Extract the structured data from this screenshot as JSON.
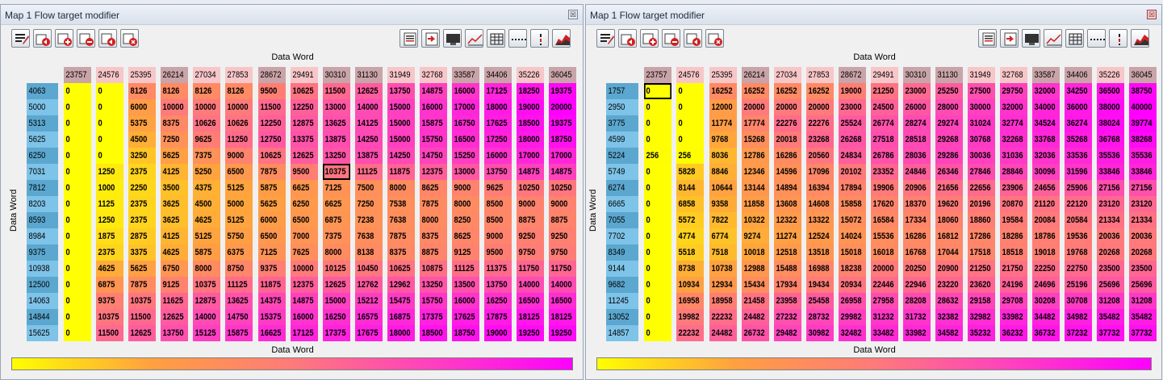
{
  "windows": [
    {
      "title": "Map 1 Flow target modifier",
      "close_label": "☒",
      "x_axis_label": "Data Word",
      "y_axis_label": "Data Word",
      "bottom_label": "Data Word",
      "x_headers": [
        "23757",
        "24576",
        "25395",
        "26214",
        "27034",
        "27853",
        "28672",
        "29491",
        "30310",
        "31130",
        "31949",
        "32768",
        "33587",
        "34406",
        "35226",
        "36045"
      ],
      "y_headers": [
        "4063",
        "5000",
        "5313",
        "5625",
        "6250",
        "7031",
        "7812",
        "8203",
        "8593",
        "8984",
        "9375",
        "10938",
        "12500",
        "14063",
        "14844",
        "15625"
      ],
      "cells": [
        [
          "0",
          "0",
          "8126",
          "8126",
          "8126",
          "8126",
          "9500",
          "10625",
          "11500",
          "12625",
          "13750",
          "14875",
          "16000",
          "17125",
          "18250",
          "19375"
        ],
        [
          "0",
          "0",
          "6000",
          "10000",
          "10000",
          "10000",
          "11500",
          "12250",
          "13000",
          "14000",
          "15000",
          "16000",
          "17000",
          "18000",
          "19000",
          "20000"
        ],
        [
          "0",
          "0",
          "5375",
          "8375",
          "10626",
          "10626",
          "12250",
          "12875",
          "13625",
          "14125",
          "15000",
          "15875",
          "16750",
          "17625",
          "18500",
          "19375"
        ],
        [
          "0",
          "0",
          "4500",
          "7250",
          "9625",
          "11250",
          "12750",
          "13375",
          "13875",
          "14250",
          "15000",
          "15750",
          "16500",
          "17250",
          "18000",
          "18750"
        ],
        [
          "0",
          "0",
          "3250",
          "5625",
          "7375",
          "9000",
          "10625",
          "12625",
          "13250",
          "13875",
          "14250",
          "14750",
          "15250",
          "16000",
          "17000",
          "17000"
        ],
        [
          "0",
          "1250",
          "2375",
          "4125",
          "5250",
          "6500",
          "7875",
          "9500",
          "10375",
          "11125",
          "11875",
          "12375",
          "13000",
          "13750",
          "14875",
          "14875"
        ],
        [
          "0",
          "1000",
          "2250",
          "3500",
          "4375",
          "5125",
          "5875",
          "6625",
          "7125",
          "7500",
          "8000",
          "8625",
          "9000",
          "9625",
          "10250",
          "10250"
        ],
        [
          "0",
          "1125",
          "2375",
          "3625",
          "4500",
          "5000",
          "5625",
          "6250",
          "6625",
          "7250",
          "7538",
          "7875",
          "8000",
          "8500",
          "9000",
          "9000"
        ],
        [
          "0",
          "1250",
          "2375",
          "3625",
          "4625",
          "5125",
          "6000",
          "6500",
          "6875",
          "7238",
          "7638",
          "8000",
          "8250",
          "8500",
          "8875",
          "8875"
        ],
        [
          "0",
          "1875",
          "2875",
          "4125",
          "5125",
          "5750",
          "6500",
          "7000",
          "7375",
          "7638",
          "7875",
          "8375",
          "8625",
          "9000",
          "9250",
          "9250"
        ],
        [
          "0",
          "2375",
          "3375",
          "4625",
          "5875",
          "6375",
          "7125",
          "7625",
          "8000",
          "8138",
          "8375",
          "8875",
          "9125",
          "9500",
          "9750",
          "9750"
        ],
        [
          "0",
          "4625",
          "5625",
          "6750",
          "8000",
          "8750",
          "9375",
          "10000",
          "10125",
          "10450",
          "10625",
          "10875",
          "11125",
          "11375",
          "11750",
          "11750"
        ],
        [
          "0",
          "6875",
          "7875",
          "9125",
          "10375",
          "11125",
          "11875",
          "12375",
          "12625",
          "12762",
          "12962",
          "13250",
          "13500",
          "13750",
          "14000",
          "14000"
        ],
        [
          "0",
          "9375",
          "10375",
          "11625",
          "12875",
          "13625",
          "14375",
          "14875",
          "15000",
          "15212",
          "15475",
          "15750",
          "16000",
          "16250",
          "16500",
          "16500"
        ],
        [
          "0",
          "10375",
          "11500",
          "12625",
          "14000",
          "14750",
          "15375",
          "16000",
          "16250",
          "16575",
          "16875",
          "17375",
          "17625",
          "17875",
          "18125",
          "18125"
        ],
        [
          "0",
          "11500",
          "12625",
          "13750",
          "15125",
          "15875",
          "16625",
          "17125",
          "17375",
          "17675",
          "18000",
          "18500",
          "18750",
          "19000",
          "19250",
          "19250"
        ]
      ]
    },
    {
      "title": "Map 1 Flow target modifier",
      "close_label": "☒",
      "x_axis_label": "Data Word",
      "y_axis_label": "Data Word",
      "bottom_label": "Data Word",
      "x_headers": [
        "23757",
        "24576",
        "25395",
        "26214",
        "27034",
        "27853",
        "28672",
        "29491",
        "30310",
        "31130",
        "31949",
        "32768",
        "33587",
        "34406",
        "35226",
        "36045"
      ],
      "y_headers": [
        "1757",
        "2950",
        "3775",
        "4599",
        "5224",
        "5749",
        "6274",
        "6665",
        "7055",
        "7702",
        "8349",
        "9144",
        "9682",
        "11245",
        "13052",
        "14857"
      ],
      "cells": [
        [
          "0",
          "0",
          "16252",
          "16252",
          "16252",
          "16252",
          "19000",
          "21250",
          "23000",
          "25250",
          "27500",
          "29750",
          "32000",
          "34250",
          "36500",
          "38750"
        ],
        [
          "0",
          "0",
          "12000",
          "20000",
          "20000",
          "20000",
          "23000",
          "24500",
          "26000",
          "28000",
          "30000",
          "32000",
          "34000",
          "36000",
          "38000",
          "40000"
        ],
        [
          "0",
          "0",
          "11774",
          "17774",
          "22276",
          "22276",
          "25524",
          "26774",
          "28274",
          "29274",
          "31024",
          "32774",
          "34524",
          "36274",
          "38024",
          "39774"
        ],
        [
          "0",
          "0",
          "9768",
          "15268",
          "20018",
          "23268",
          "26268",
          "27518",
          "28518",
          "29268",
          "30768",
          "32268",
          "33768",
          "35268",
          "36768",
          "38268"
        ],
        [
          "256",
          "256",
          "8036",
          "12786",
          "16286",
          "20560",
          "24834",
          "26786",
          "28036",
          "29286",
          "30036",
          "31036",
          "32036",
          "33536",
          "35536",
          "35536"
        ],
        [
          "0",
          "5828",
          "8846",
          "12346",
          "14596",
          "17096",
          "20102",
          "23352",
          "24846",
          "26346",
          "27846",
          "28846",
          "30096",
          "31596",
          "33846",
          "33846"
        ],
        [
          "0",
          "8144",
          "10644",
          "13144",
          "14894",
          "16394",
          "17894",
          "19906",
          "20906",
          "21656",
          "22656",
          "23906",
          "24656",
          "25906",
          "27156",
          "27156"
        ],
        [
          "0",
          "6858",
          "9358",
          "11858",
          "13608",
          "14608",
          "15858",
          "17620",
          "18370",
          "19620",
          "20196",
          "20870",
          "21120",
          "22120",
          "23120",
          "23120"
        ],
        [
          "0",
          "5572",
          "7822",
          "10322",
          "12322",
          "13322",
          "15072",
          "16584",
          "17334",
          "18060",
          "18860",
          "19584",
          "20084",
          "20584",
          "21334",
          "21334"
        ],
        [
          "0",
          "4774",
          "6774",
          "9274",
          "11274",
          "12524",
          "14024",
          "15536",
          "16286",
          "16812",
          "17286",
          "18286",
          "18786",
          "19536",
          "20036",
          "20036"
        ],
        [
          "0",
          "5518",
          "7518",
          "10018",
          "12518",
          "13518",
          "15018",
          "16018",
          "16768",
          "17044",
          "17518",
          "18518",
          "19018",
          "19768",
          "20268",
          "20268"
        ],
        [
          "0",
          "8738",
          "10738",
          "12988",
          "15488",
          "16988",
          "18238",
          "20000",
          "20250",
          "20900",
          "21250",
          "21750",
          "22250",
          "22750",
          "23500",
          "23500"
        ],
        [
          "0",
          "10934",
          "12934",
          "15434",
          "17934",
          "19434",
          "20934",
          "22446",
          "22946",
          "23220",
          "23620",
          "24196",
          "24696",
          "25196",
          "25696",
          "25696"
        ],
        [
          "0",
          "16958",
          "18958",
          "21458",
          "23958",
          "25458",
          "26958",
          "27958",
          "28208",
          "28632",
          "29158",
          "29708",
          "30208",
          "30708",
          "31208",
          "31208"
        ],
        [
          "0",
          "19982",
          "22232",
          "24482",
          "27232",
          "28732",
          "29982",
          "31232",
          "31732",
          "32382",
          "32982",
          "33982",
          "34482",
          "34982",
          "35482",
          "35482"
        ],
        [
          "0",
          "22232",
          "24482",
          "26732",
          "29482",
          "30982",
          "32482",
          "33482",
          "33982",
          "34582",
          "35232",
          "36232",
          "36732",
          "37232",
          "37732",
          "37732"
        ]
      ]
    }
  ],
  "toolbar_left_icons": [
    "edit-icon",
    "undo-icon",
    "add-icon",
    "remove-icon",
    "undo-all-icon",
    "clear-icon"
  ],
  "toolbar_right_icons": [
    "paste-icon",
    "import-icon",
    "monitor-icon",
    "line-graph-icon",
    "grid-icon",
    "dashed-line-icon",
    "vertical-bar-icon",
    "area-chart-icon"
  ],
  "colors": {
    "low": "#ffff00",
    "mid": "#ff8080",
    "high": "#ff00ff"
  }
}
